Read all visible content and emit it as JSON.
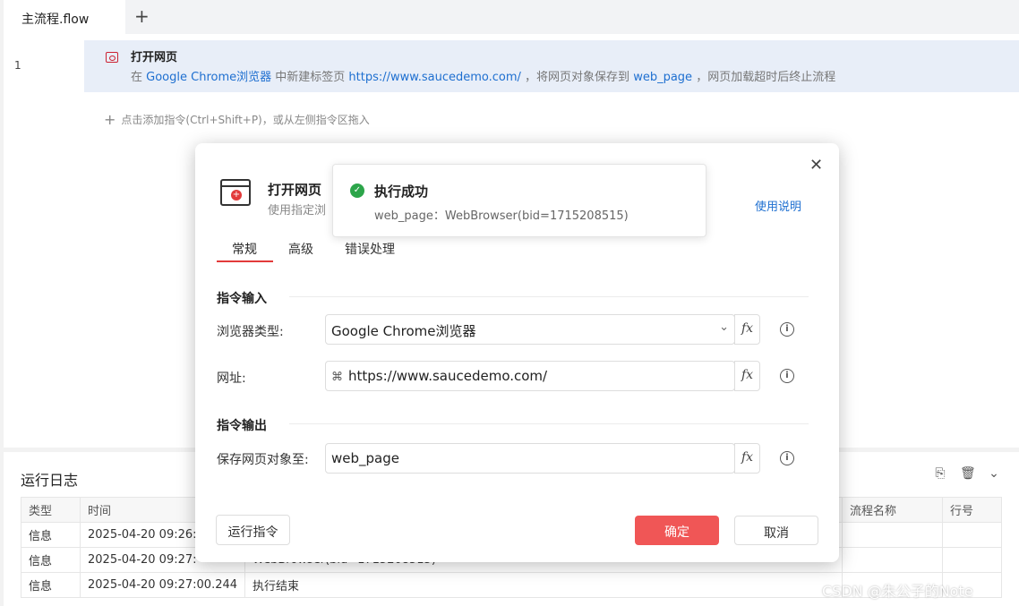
{
  "editor": {
    "tab_label": "主流程.flow",
    "add_tab": "+",
    "line_number": "1",
    "step": {
      "title": "打开网页",
      "desc_prefix": "在",
      "browser": "Google Chrome浏览器",
      "desc_mid": "中新建标签页",
      "url": "https://www.saucedemo.com/",
      "desc_mid2": "，将网页对象保存到",
      "var": "web_page",
      "desc_suffix": "，网页加载超时后终止流程"
    },
    "add_hint": "点击添加指令(Ctrl+Shift+P)，或从左侧指令区拖入"
  },
  "log": {
    "title": "运行日志",
    "columns": [
      "类型",
      "时间",
      "",
      "流程名称",
      "行号"
    ],
    "rows": [
      {
        "type": "信息",
        "time": "2025-04-20 09:26:",
        "msg": "",
        "flow": "",
        "line": ""
      },
      {
        "type": "信息",
        "time": "2025-04-20 09:27:",
        "msg": "WebBrowser(bid=1715208515)",
        "flow": "",
        "line": ""
      },
      {
        "type": "信息",
        "time": "2025-04-20 09:27:00.244",
        "msg": "执行结束",
        "flow": "",
        "line": ""
      }
    ]
  },
  "dialog": {
    "title": "打开网页",
    "subtitle": "使用指定浏",
    "help": "使用说明",
    "tabs": [
      "常规",
      "高级",
      "错误处理"
    ],
    "section_input": "指令输入",
    "browser_label": "浏览器类型:",
    "browser_value": "Google Chrome浏览器",
    "url_label": "网址:",
    "url_value": "https://www.saucedemo.com/",
    "section_output": "指令输出",
    "save_label": "保存网页对象至:",
    "save_value": "web_page",
    "fx": "fx",
    "run_button": "运行指令",
    "ok_button": "确定",
    "cancel_button": "取消"
  },
  "toast": {
    "title": "执行成功",
    "message": "web_page：WebBrowser(bid=1715208515)"
  },
  "watermark": "CSDN @朱公子的Note",
  "colors": {
    "accent": "#e23a3a",
    "link": "#1e6fd0",
    "success": "#2ca54a",
    "ok_button": "#f05656"
  }
}
